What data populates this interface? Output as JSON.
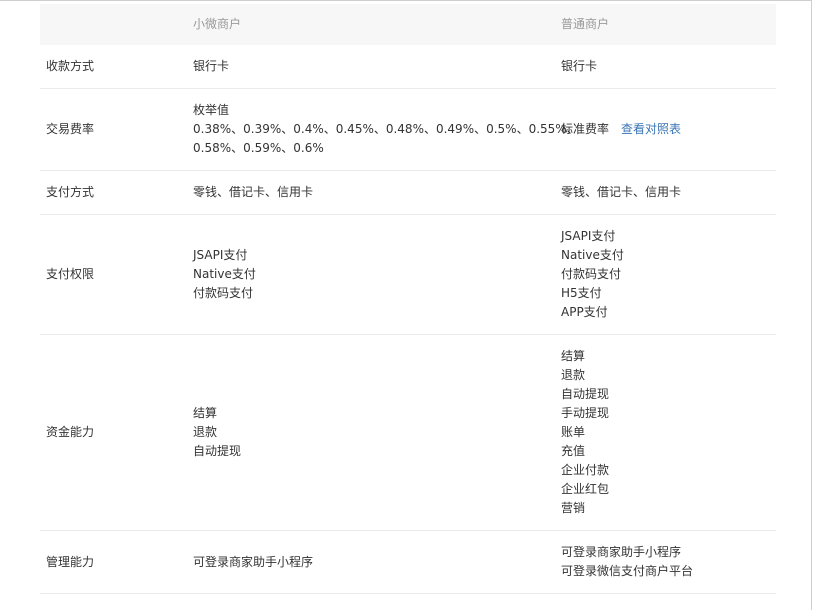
{
  "header": {
    "col1": "",
    "col2": "小微商户",
    "col3": "普通商户"
  },
  "rows": {
    "payee": {
      "label": "收款方式",
      "small": [
        "银行卡"
      ],
      "normal": [
        "银行卡"
      ]
    },
    "fee": {
      "label": "交易费率",
      "small": [
        "枚举值",
        "0.38%、0.39%、0.4%、0.45%、0.48%、0.49%、0.5%、0.55%、",
        "0.58%、0.59%、0.6%"
      ],
      "normal_text": "标准费率",
      "normal_link": "查看对照表"
    },
    "payment": {
      "label": "支付方式",
      "small": [
        "零钱、借记卡、信用卡"
      ],
      "normal": [
        "零钱、借记卡、信用卡"
      ]
    },
    "permission": {
      "label": "支付权限",
      "small": [
        "JSAPI支付",
        "Native支付",
        "付款码支付"
      ],
      "normal": [
        "JSAPI支付",
        "Native支付",
        "付款码支付",
        "H5支付",
        "APP支付"
      ]
    },
    "capital": {
      "label": "资金能力",
      "small": [
        "结算",
        "退款",
        "自动提现"
      ],
      "normal": [
        "结算",
        "退款",
        "自动提现",
        "手动提现",
        "账单",
        "充值",
        "企业付款",
        "企业红包",
        "营销"
      ]
    },
    "manage": {
      "label": "管理能力",
      "small": [
        "可登录商家助手小程序"
      ],
      "normal": [
        "可登录商家助手小程序",
        "可登录微信支付商户平台"
      ]
    }
  }
}
